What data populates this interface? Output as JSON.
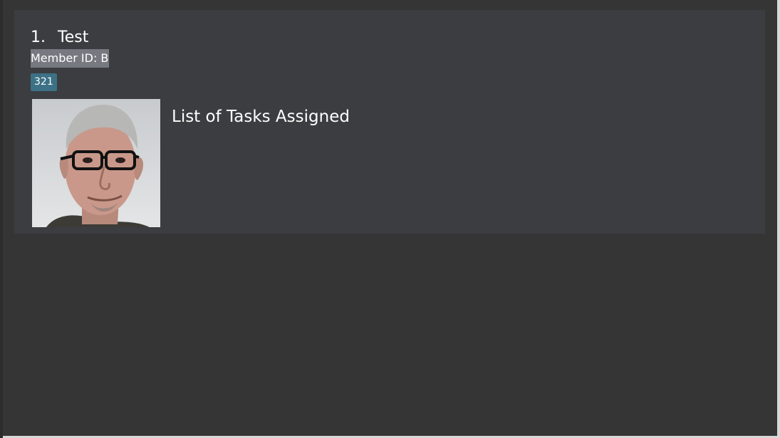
{
  "member": {
    "index": "1.",
    "name": "Test",
    "member_id": "Member ID: B",
    "tag": "321",
    "tasks_heading": "List of Tasks Assigned"
  }
}
